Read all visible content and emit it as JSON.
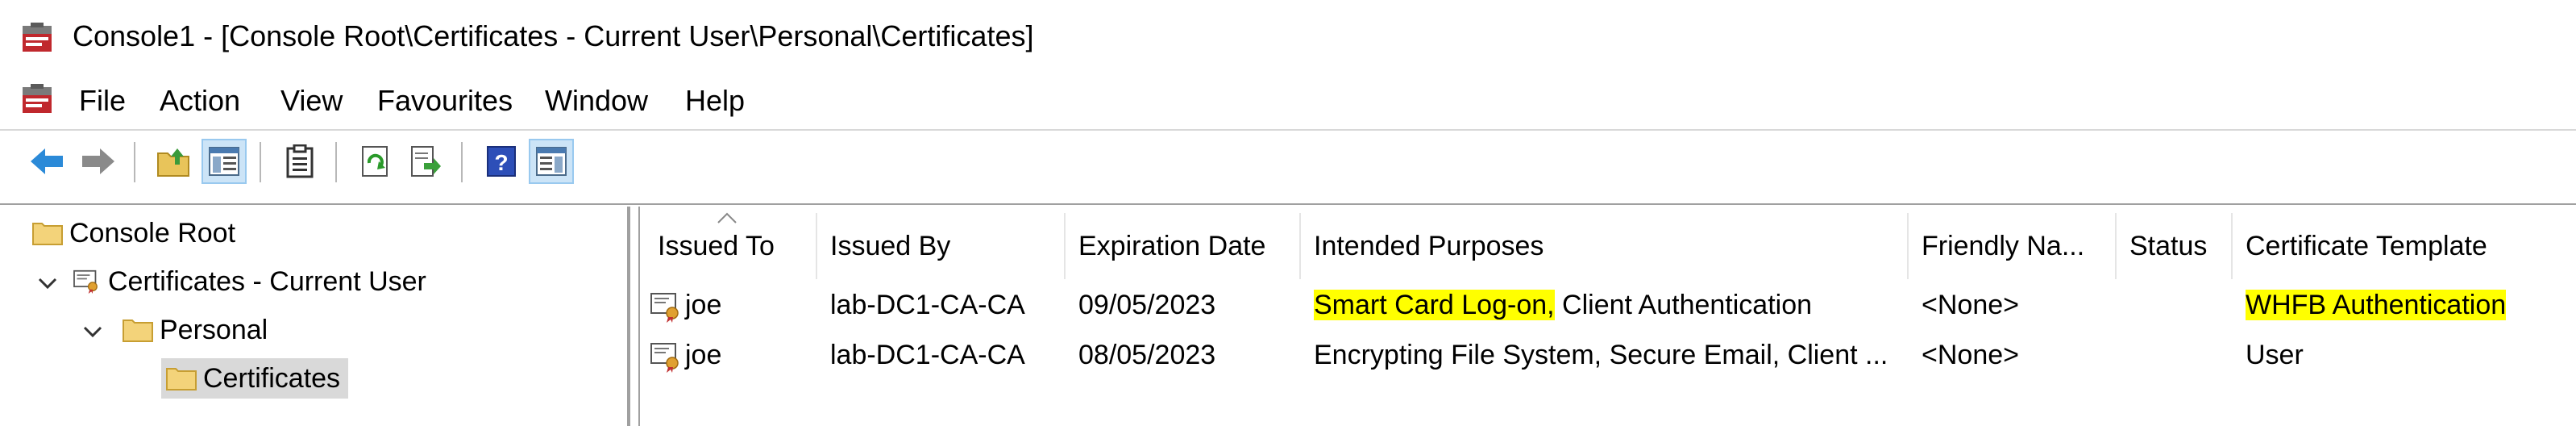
{
  "window": {
    "title": "Console1 - [Console Root\\Certificates - Current User\\Personal\\Certificates]"
  },
  "menu": {
    "items": [
      "File",
      "Action",
      "View",
      "Favourites",
      "Window",
      "Help"
    ]
  },
  "toolbar": {
    "buttons": [
      "back-arrow-icon",
      "forward-arrow-icon",
      "up-folder-icon",
      "show-hide-tree-icon",
      "properties-clipboard-icon",
      "refresh-icon",
      "export-list-icon",
      "help-icon",
      "show-hide-action-pane-icon"
    ]
  },
  "tree": {
    "items": [
      {
        "label": "Console Root"
      },
      {
        "label": "Certificates - Current User"
      },
      {
        "label": "Personal"
      },
      {
        "label": "Certificates"
      }
    ]
  },
  "list": {
    "columns": [
      "Issued To",
      "Issued By",
      "Expiration Date",
      "Intended Purposes",
      "Friendly Na...",
      "Status",
      "Certificate Template"
    ],
    "rows": [
      {
        "issued_to": "joe",
        "issued_by": "lab-DC1-CA-CA",
        "expiration": "09/05/2023",
        "purposes_highlight": "Smart Card Log-on,",
        "purposes_rest": " Client Authentication",
        "friendly_name": "<None>",
        "status": "",
        "template": "WHFB Authentication"
      },
      {
        "issued_to": "joe",
        "issued_by": "lab-DC1-CA-CA",
        "expiration": "08/05/2023",
        "purposes_highlight": "",
        "purposes_rest": "Encrypting File System, Secure Email, Client ...",
        "friendly_name": "<None>",
        "status": "",
        "template": "User"
      }
    ]
  },
  "colors": {
    "highlight": "#ffff00",
    "selection": "#d9d9d9",
    "pressed_button": "#cce4f7"
  }
}
